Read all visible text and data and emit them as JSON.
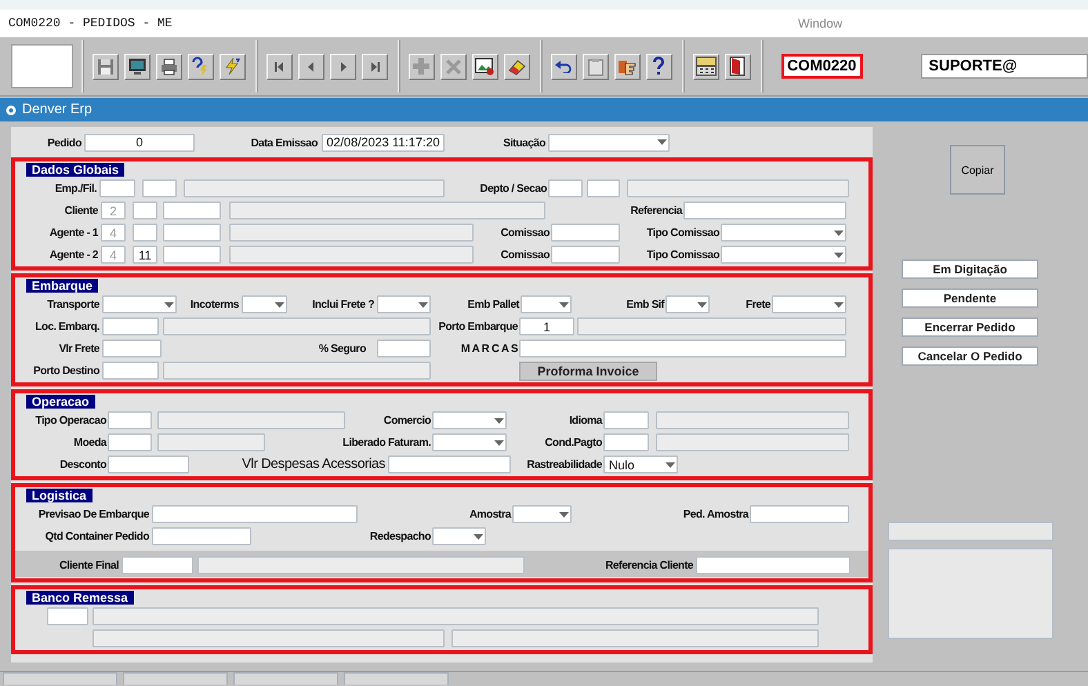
{
  "window": {
    "title": "COM0220 - PEDIDOS - ME",
    "menu": "Window"
  },
  "module_code": {
    "text": "COM0220",
    "highlighted": true
  },
  "user_field": {
    "value": "SUPORTE@"
  },
  "app_bar": {
    "title": "Denver Erp"
  },
  "header_fields": [
    {
      "kind": "labeled",
      "label": "Pedido",
      "controls": [
        {
          "kind": "input",
          "value": "0"
        }
      ]
    },
    {
      "kind": "labeled",
      "label": "Data Emissao",
      "controls": [
        {
          "kind": "input",
          "value": "02/08/2023 11:17:20"
        }
      ]
    },
    {
      "kind": "labeled",
      "label": "Situação",
      "controls": [
        {
          "kind": "select"
        }
      ]
    }
  ],
  "sections": [
    {
      "title": "Dados Globais",
      "highlighted": true,
      "fields": [
        {
          "kind": "labeled",
          "label": "Emp./Fil.",
          "controls": [
            {
              "kind": "input"
            },
            {
              "kind": "input"
            },
            {
              "kind": "readonly"
            }
          ]
        },
        {
          "kind": "labeled",
          "label": "Depto / Secao",
          "controls": [
            {
              "kind": "input"
            },
            {
              "kind": "input"
            },
            {
              "kind": "readonly"
            }
          ]
        },
        {
          "kind": "labeled",
          "label": "Cliente",
          "controls": [
            {
              "kind": "dim-input",
              "value": "2"
            },
            {
              "kind": "input"
            },
            {
              "kind": "input"
            },
            {
              "kind": "readonly"
            }
          ]
        },
        {
          "kind": "labeled",
          "label": "Referencia",
          "controls": [
            {
              "kind": "input"
            }
          ]
        },
        {
          "kind": "labeled",
          "label": "Agente - 1",
          "controls": [
            {
              "kind": "dim-input",
              "value": "4"
            },
            {
              "kind": "input"
            },
            {
              "kind": "input"
            },
            {
              "kind": "readonly"
            }
          ]
        },
        {
          "kind": "labeled",
          "label": "Comissao",
          "controls": [
            {
              "kind": "input"
            }
          ]
        },
        {
          "kind": "labeled",
          "label": "Tipo Comissao",
          "controls": [
            {
              "kind": "select"
            }
          ]
        },
        {
          "kind": "labeled",
          "label": "Agente - 2",
          "controls": [
            {
              "kind": "dim-input",
              "value": "4"
            },
            {
              "kind": "input",
              "value": "11"
            },
            {
              "kind": "input"
            },
            {
              "kind": "readonly"
            }
          ]
        },
        {
          "kind": "labeled",
          "label": "Comissao",
          "controls": [
            {
              "kind": "input"
            }
          ]
        },
        {
          "kind": "labeled",
          "label": "Tipo Comissao",
          "controls": [
            {
              "kind": "select"
            }
          ]
        }
      ]
    },
    {
      "title": "Embarque",
      "highlighted": true,
      "fields": [
        {
          "kind": "labeled",
          "label": "Transporte",
          "controls": [
            {
              "kind": "select"
            }
          ]
        },
        {
          "kind": "labeled",
          "label": "Incoterms",
          "controls": [
            {
              "kind": "select"
            }
          ]
        },
        {
          "kind": "labeled",
          "label": "Inclui Frete ?",
          "controls": [
            {
              "kind": "select"
            }
          ]
        },
        {
          "kind": "labeled",
          "label": "Emb Pallet",
          "controls": [
            {
              "kind": "select"
            }
          ]
        },
        {
          "kind": "labeled",
          "label": "Emb Sif",
          "controls": [
            {
              "kind": "select"
            }
          ]
        },
        {
          "kind": "labeled",
          "label": "Frete",
          "controls": [
            {
              "kind": "select"
            }
          ]
        },
        {
          "kind": "labeled",
          "label": "Loc. Embarq.",
          "controls": [
            {
              "kind": "input"
            },
            {
              "kind": "readonly"
            }
          ]
        },
        {
          "kind": "labeled",
          "label": "Porto Embarque",
          "controls": [
            {
              "kind": "input",
              "value": "1"
            },
            {
              "kind": "readonly"
            }
          ]
        },
        {
          "kind": "labeled",
          "label": "Vlr Frete",
          "controls": [
            {
              "kind": "input"
            }
          ]
        },
        {
          "kind": "labeled",
          "label": "% Seguro",
          "controls": [
            {
              "kind": "input"
            }
          ]
        },
        {
          "kind": "labeled",
          "label": "M A R C A S",
          "controls": [
            {
              "kind": "input"
            }
          ]
        },
        {
          "kind": "labeled",
          "label": "Porto Destino",
          "controls": [
            {
              "kind": "input"
            },
            {
              "kind": "readonly"
            }
          ]
        },
        {
          "kind": "plain",
          "controls": [
            {
              "kind": "button",
              "text": "Proforma Invoice"
            }
          ]
        }
      ]
    },
    {
      "title": "Operacao",
      "highlighted": true,
      "fields": [
        {
          "kind": "labeled",
          "label": "Tipo Operacao",
          "controls": [
            {
              "kind": "input"
            },
            {
              "kind": "readonly"
            }
          ]
        },
        {
          "kind": "labeled",
          "label": "Comercio",
          "controls": [
            {
              "kind": "select"
            }
          ]
        },
        {
          "kind": "labeled",
          "label": "Idioma",
          "controls": [
            {
              "kind": "input"
            },
            {
              "kind": "readonly"
            }
          ]
        },
        {
          "kind": "labeled",
          "label": "Moeda",
          "controls": [
            {
              "kind": "input"
            },
            {
              "kind": "readonly"
            }
          ]
        },
        {
          "kind": "labeled",
          "label": "Liberado Faturam.",
          "controls": [
            {
              "kind": "select"
            }
          ]
        },
        {
          "kind": "labeled",
          "label": "Cond.Pagto",
          "controls": [
            {
              "kind": "input"
            },
            {
              "kind": "readonly"
            }
          ]
        },
        {
          "kind": "labeled",
          "label": "Desconto",
          "controls": [
            {
              "kind": "input"
            }
          ]
        },
        {
          "kind": "caption",
          "label": "Vlr Despesas Acessorias",
          "controls": [
            {
              "kind": "input"
            }
          ]
        },
        {
          "kind": "labeled",
          "label": "Rastreabilidade",
          "controls": [
            {
              "kind": "select",
              "value": "Nulo"
            }
          ]
        }
      ]
    },
    {
      "title": "Logistica",
      "highlighted": true,
      "fields": [
        {
          "kind": "labeled",
          "label": "Previsao De Embarque",
          "controls": [
            {
              "kind": "input"
            }
          ]
        },
        {
          "kind": "labeled",
          "label": "Amostra",
          "controls": [
            {
              "kind": "select"
            }
          ]
        },
        {
          "kind": "labeled",
          "label": "Ped. Amostra",
          "controls": [
            {
              "kind": "input"
            }
          ]
        },
        {
          "kind": "labeled",
          "label": "Qtd Container Pedido",
          "controls": [
            {
              "kind": "input"
            }
          ]
        },
        {
          "kind": "labeled",
          "label": "Redespacho",
          "controls": [
            {
              "kind": "select"
            }
          ]
        }
      ],
      "footer_fields": [
        {
          "kind": "labeled",
          "label": "Cliente Final",
          "controls": [
            {
              "kind": "input"
            },
            {
              "kind": "readonly"
            }
          ]
        },
        {
          "kind": "labeled",
          "label": "Referencia Cliente",
          "controls": [
            {
              "kind": "input"
            }
          ]
        }
      ]
    },
    {
      "title": "Banco Remessa",
      "highlighted": true,
      "fields": [
        {
          "kind": "plain",
          "controls": [
            {
              "kind": "input"
            },
            {
              "kind": "readonly"
            }
          ]
        },
        {
          "kind": "plain",
          "controls": [
            {
              "kind": "readonly"
            },
            {
              "kind": "readonly"
            }
          ]
        }
      ]
    }
  ],
  "copy_button": {
    "label": "Copiar"
  },
  "status_buttons": [
    "Em Digitação",
    "Pendente",
    "Encerrar Pedido",
    "Cancelar O Pedido"
  ]
}
